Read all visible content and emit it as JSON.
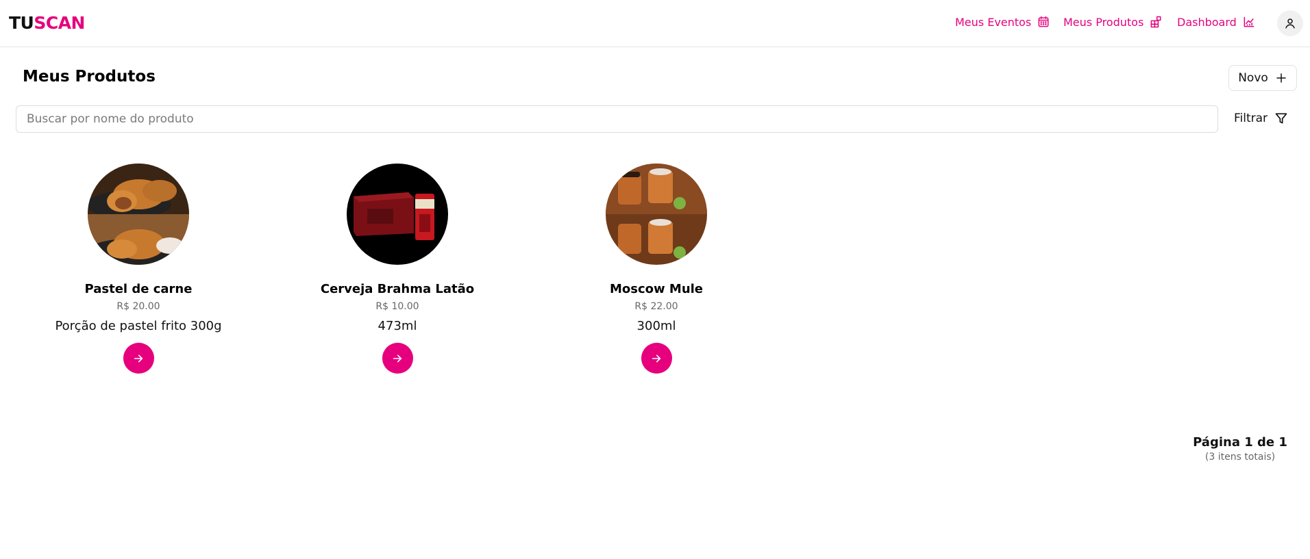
{
  "app": {
    "logo_part1": "TU",
    "logo_part2": "SCAN",
    "accent": "#e6007e"
  },
  "nav": {
    "events": {
      "label": "Meus Eventos",
      "icon": "calendar-icon"
    },
    "products": {
      "label": "Meus Produtos",
      "icon": "products-icon"
    },
    "dashboard": {
      "label": "Dashboard",
      "icon": "chart-icon"
    },
    "profile_icon": "user-icon"
  },
  "page": {
    "title": "Meus Produtos",
    "new_button": "Novo",
    "search_placeholder": "Buscar por nome do produto",
    "filter_label": "Filtrar"
  },
  "products": [
    {
      "name": "Pastel de carne",
      "price": "R$ 20.00",
      "description": "Porção de pastel frito 300g"
    },
    {
      "name": "Cerveja Brahma Latão",
      "price": "R$ 10.00",
      "description": "473ml"
    },
    {
      "name": "Moscow Mule",
      "price": "R$ 22.00",
      "description": "300ml"
    }
  ],
  "pagination": {
    "label": "Página 1 de 1",
    "total": "(3 itens totais)"
  }
}
